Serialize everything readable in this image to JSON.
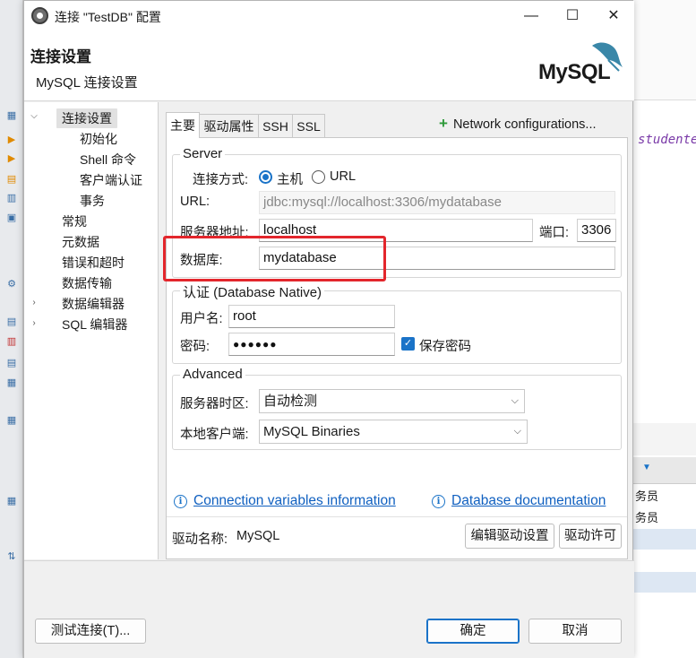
{
  "title": "连接 \"TestDB\" 配置",
  "window_controls": {
    "minimize": "—",
    "maximize": "☐",
    "close": "✕"
  },
  "header": {
    "title": "连接设置",
    "subtitle": "MySQL 连接设置",
    "logo_text": "MySQL"
  },
  "nav": [
    {
      "label": "连接设置",
      "level": 0,
      "expanded": true,
      "selected": true
    },
    {
      "label": "初始化",
      "level": 1
    },
    {
      "label": "Shell 命令",
      "level": 1
    },
    {
      "label": "客户端认证",
      "level": 1
    },
    {
      "label": "事务",
      "level": 1
    },
    {
      "label": "常规",
      "level": 0
    },
    {
      "label": "元数据",
      "level": 0
    },
    {
      "label": "错误和超时",
      "level": 0
    },
    {
      "label": "数据传输",
      "level": 0
    },
    {
      "label": "数据编辑器",
      "level": 0,
      "expandable": true
    },
    {
      "label": "SQL 编辑器",
      "level": 0,
      "expandable": true
    }
  ],
  "tabs": [
    "主要",
    "驱动属性",
    "SSH",
    "SSL"
  ],
  "network_config": "Network configurations...",
  "server": {
    "legend": "Server",
    "connect_mode_label": "连接方式:",
    "mode_host": "主机",
    "mode_url": "URL",
    "url_label": "URL:",
    "url_value": "jdbc:mysql://localhost:3306/mydatabase",
    "host_label": "服务器地址:",
    "host_value": "localhost",
    "port_label": "端口:",
    "port_value": "3306",
    "db_label": "数据库:",
    "db_value": "mydatabase"
  },
  "auth": {
    "legend": "认证 (Database Native)",
    "user_label": "用户名:",
    "user_value": "root",
    "password_label": "密码:",
    "password_value": "●●●●●●",
    "save_password": "保存密码"
  },
  "advanced": {
    "legend": "Advanced",
    "timezone_label": "服务器时区:",
    "timezone_value": "自动检测",
    "client_label": "本地客户端:",
    "client_value": "MySQL Binaries"
  },
  "links": {
    "conn_vars": "Connection variables information",
    "db_docs": "Database documentation"
  },
  "driver": {
    "label": "驱动名称:",
    "value": "MySQL",
    "edit_button": "编辑驱动设置",
    "license_button": "驱动许可"
  },
  "footer": {
    "test_button": "测试连接(T)...",
    "ok_button": "确定",
    "cancel_button": "取消"
  },
  "background": {
    "editor_text": "studente",
    "grid_rows": [
      "务员",
      "务员"
    ]
  }
}
